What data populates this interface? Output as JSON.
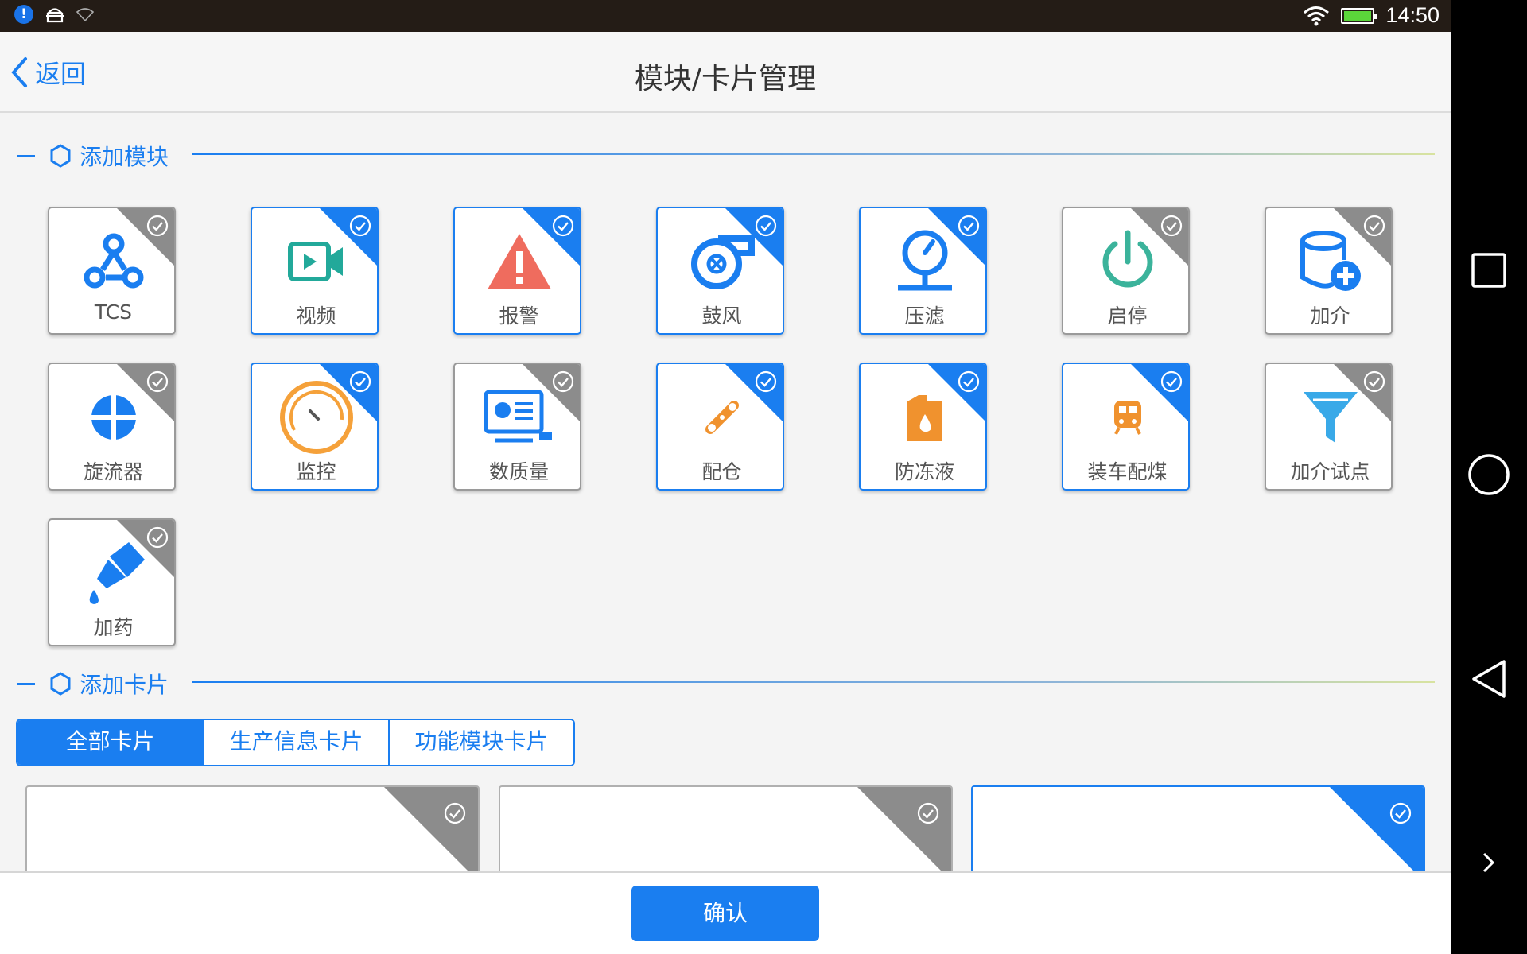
{
  "status_bar": {
    "time": "14:50"
  },
  "header": {
    "back_label": "返回",
    "title": "模块/卡片管理"
  },
  "modules_section": {
    "title": "添加模块"
  },
  "modules": [
    {
      "label": "TCS",
      "icon": "tcs-network-icon",
      "color": "#1a7ef0",
      "selected": false
    },
    {
      "label": "视频",
      "icon": "video-camera-icon",
      "color": "#22a99a",
      "selected": true
    },
    {
      "label": "报警",
      "icon": "alarm-warning-icon",
      "color": "#ef6c5e",
      "selected": true
    },
    {
      "label": "鼓风",
      "icon": "blower-fan-icon",
      "color": "#1a7ef0",
      "selected": true
    },
    {
      "label": "压滤",
      "icon": "pressure-gauge-icon",
      "color": "#1a7ef0",
      "selected": true
    },
    {
      "label": "启停",
      "icon": "power-icon",
      "color": "#3bb39b",
      "selected": false
    },
    {
      "label": "加介",
      "icon": "database-add-icon",
      "color": "#1a7ef0",
      "selected": false
    },
    {
      "label": "旋流器",
      "icon": "cyclone-icon",
      "color": "#1a7ef0",
      "selected": false
    },
    {
      "label": "监控",
      "icon": "speedometer-icon",
      "color": "#f5a13a",
      "selected": true
    },
    {
      "label": "数质量",
      "icon": "data-monitor-icon",
      "color": "#1a7ef0",
      "selected": false
    },
    {
      "label": "配仓",
      "icon": "belt-icon",
      "color": "#f0922e",
      "selected": true
    },
    {
      "label": "防冻液",
      "icon": "antifreeze-can-icon",
      "color": "#f0922e",
      "selected": true
    },
    {
      "label": "装车配煤",
      "icon": "train-icon",
      "color": "#f0922e",
      "selected": true
    },
    {
      "label": "加介试点",
      "icon": "filter-funnel-icon",
      "color": "#39a9e8",
      "selected": false
    },
    {
      "label": "加药",
      "icon": "dropper-bottle-icon",
      "color": "#1a7ef0",
      "selected": false
    }
  ],
  "cards_section": {
    "title": "添加卡片"
  },
  "card_tabs": [
    {
      "label": "全部卡片",
      "active": true
    },
    {
      "label": "生产信息卡片",
      "active": false
    },
    {
      "label": "功能模块卡片",
      "active": false
    }
  ],
  "cards": [
    {
      "selected": false
    },
    {
      "selected": false
    },
    {
      "selected": true
    }
  ],
  "footer": {
    "confirm_label": "确认"
  }
}
